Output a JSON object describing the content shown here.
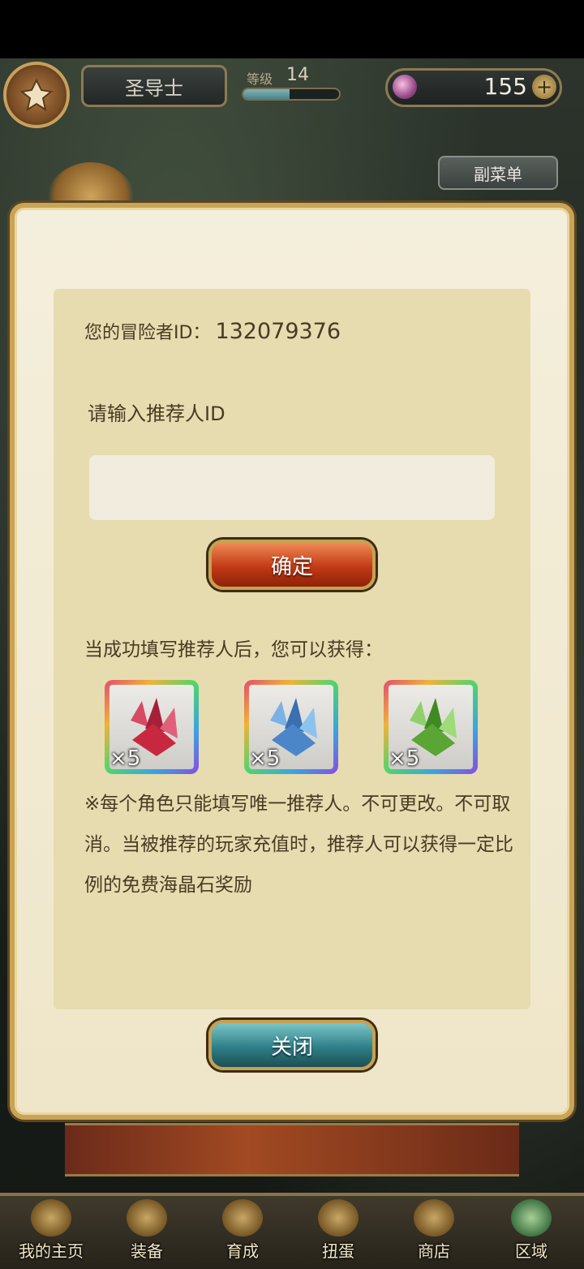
{
  "hud": {
    "class_name": "圣导士",
    "level_label": "等级",
    "level_value": "14",
    "level_progress": 0.48,
    "gem_count": "155",
    "submenu_label": "副菜单"
  },
  "dialog": {
    "id_label": "您的冒险者ID：",
    "id_value": "132079376",
    "prompt": "请输入推荐人ID",
    "input_value": "",
    "confirm_label": "确定",
    "reward_title": "当成功填写推荐人后，您可以获得：",
    "rewards": [
      {
        "icon": "red-crystal-icon",
        "qty": "×5",
        "color": "#c8283f"
      },
      {
        "icon": "blue-crystal-icon",
        "qty": "×5",
        "color": "#4a86c8"
      },
      {
        "icon": "green-crystal-icon",
        "qty": "×5",
        "color": "#5aa534"
      }
    ],
    "note": "※每个角色只能填写唯一推荐人。不可更改。不可取消。当被推荐的玩家充值时，推荐人可以获得一定比例的免费海晶石奖励",
    "close_label": "关闭"
  },
  "nav": [
    {
      "label": "我的主页",
      "icon": "scroll-icon"
    },
    {
      "label": "装备",
      "icon": "helmet-icon"
    },
    {
      "label": "育成",
      "icon": "sword-icon"
    },
    {
      "label": "扭蛋",
      "icon": "capsule-icon"
    },
    {
      "label": "商店",
      "icon": "bag-icon"
    },
    {
      "label": "区域",
      "icon": "globe-icon",
      "active": true
    }
  ]
}
